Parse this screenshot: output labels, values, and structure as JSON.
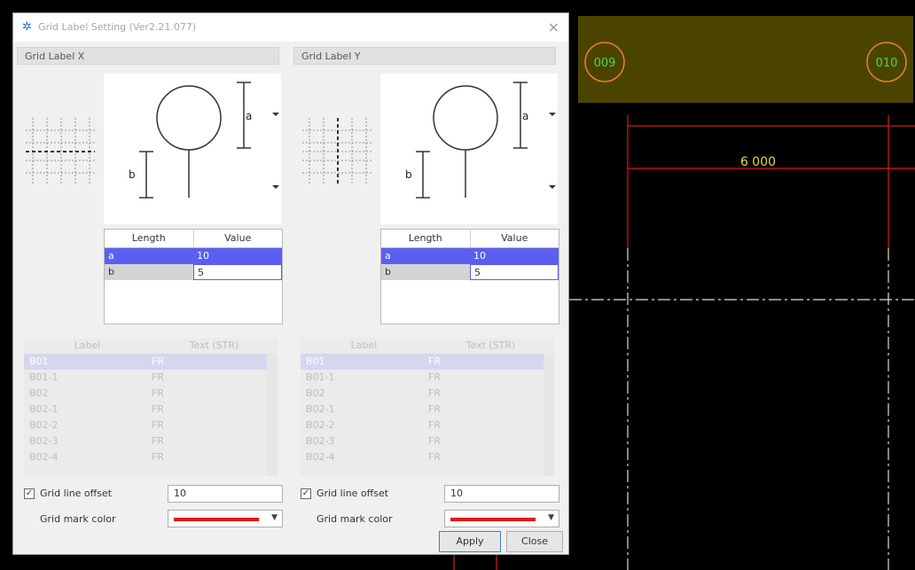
{
  "window": {
    "title": "Grid Label Setting (Ver2.21.077)",
    "close_glyph": "×"
  },
  "panel_x": {
    "header": "Grid Label X",
    "dim_a": "a",
    "dim_b": "b",
    "length_table": {
      "headers": [
        "Length",
        "Value"
      ],
      "rows": [
        {
          "length": "a",
          "value": "10"
        },
        {
          "length": "b",
          "value": "5"
        }
      ]
    },
    "label_list": {
      "headers": [
        "Label",
        "Text (STR)"
      ],
      "rows": [
        {
          "label": "B01",
          "text": "FR"
        },
        {
          "label": "B01-1",
          "text": "FR"
        },
        {
          "label": "B02",
          "text": "FR"
        },
        {
          "label": "B02-1",
          "text": "FR"
        },
        {
          "label": "B02-2",
          "text": "FR"
        },
        {
          "label": "B02-3",
          "text": "FR"
        },
        {
          "label": "B02-4",
          "text": "FR"
        }
      ]
    },
    "grid_line_offset": {
      "label": "Grid line offset",
      "checked": true,
      "value": "10"
    },
    "grid_mark_color": {
      "label": "Grid mark color",
      "color": "#e01818"
    }
  },
  "panel_y": {
    "header": "Grid Label Y",
    "dim_a": "a",
    "dim_b": "b",
    "length_table": {
      "headers": [
        "Length",
        "Value"
      ],
      "rows": [
        {
          "length": "a",
          "value": "10"
        },
        {
          "length": "b",
          "value": "5"
        }
      ]
    },
    "label_list": {
      "headers": [
        "Label",
        "Text (STR)"
      ],
      "rows": [
        {
          "label": "B01",
          "text": "FR"
        },
        {
          "label": "B01-1",
          "text": "FR"
        },
        {
          "label": "B02",
          "text": "FR"
        },
        {
          "label": "B02-1",
          "text": "FR"
        },
        {
          "label": "B02-2",
          "text": "FR"
        },
        {
          "label": "B02-3",
          "text": "FR"
        },
        {
          "label": "B02-4",
          "text": "FR"
        }
      ]
    },
    "grid_line_offset": {
      "label": "Grid line offset",
      "checked": true,
      "value": "10"
    },
    "grid_mark_color": {
      "label": "Grid mark color",
      "color": "#e01818"
    }
  },
  "buttons": {
    "apply": "Apply",
    "close": "Close"
  },
  "cad": {
    "marker_left": "009",
    "marker_right": "010",
    "dimension": "6 000",
    "colors": {
      "band": "#4a4400",
      "marker": "#e8821e",
      "marker_text": "#4fd84f",
      "dim_line": "#e01818",
      "dim_text": "#e6d84a"
    }
  }
}
